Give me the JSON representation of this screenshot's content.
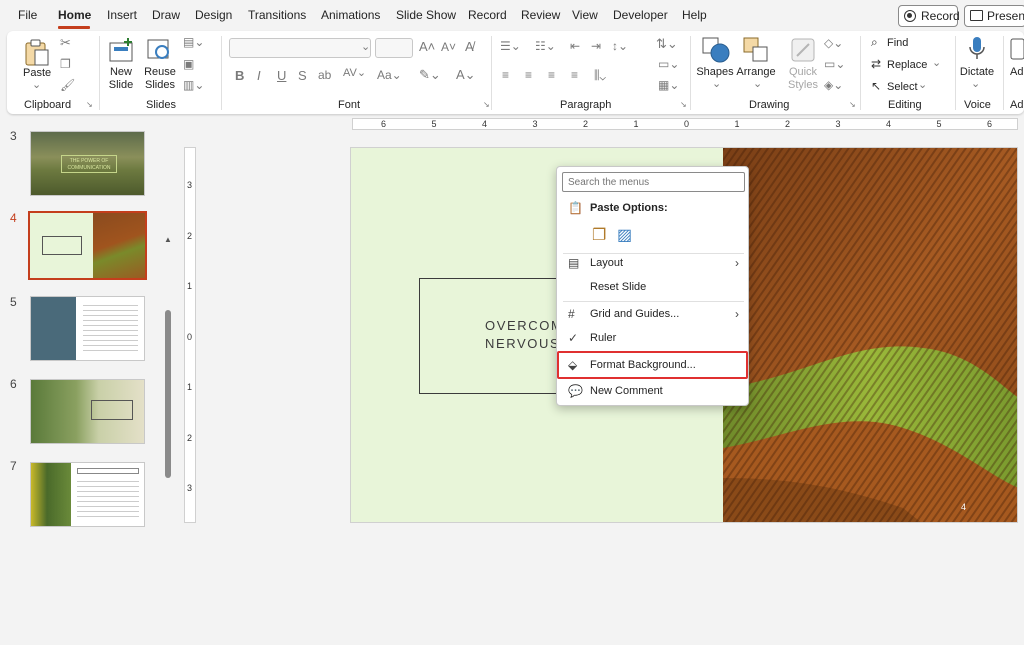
{
  "menu": {
    "tabs": [
      "File",
      "Home",
      "Insert",
      "Draw",
      "Design",
      "Transitions",
      "Animations",
      "Slide Show",
      "Record",
      "Review",
      "View",
      "Developer",
      "Help"
    ],
    "record_button": "Record",
    "present_button": "Present"
  },
  "ribbon": {
    "clipboard": {
      "paste": "Paste",
      "group": "Clipboard"
    },
    "slides": {
      "new_slide_1": "New",
      "new_slide_2": "Slide",
      "reuse_1": "Reuse",
      "reuse_2": "Slides",
      "group": "Slides"
    },
    "font": {
      "group": "Font"
    },
    "paragraph": {
      "group": "Paragraph"
    },
    "drawing": {
      "shapes": "Shapes",
      "arrange": "Arrange",
      "quick_styles_1": "Quick",
      "quick_styles_2": "Styles",
      "group": "Drawing"
    },
    "editing": {
      "find": "Find",
      "replace": "Replace",
      "select": "Select",
      "group": "Editing"
    },
    "voice": {
      "dictate": "Dictate",
      "group": "Voice"
    },
    "addins": {
      "label": "Ad",
      "group": "Ad"
    }
  },
  "thumbnails": {
    "numbers": [
      "3",
      "4",
      "5",
      "6",
      "7"
    ],
    "slide3_title_1": "THE POWER OF",
    "slide3_title_2": "COMMUNICATION"
  },
  "slide": {
    "title_line1": "OVERCOM",
    "title_line2": "NERVOUS",
    "number": "4"
  },
  "context_menu": {
    "search_placeholder": "Search the menus",
    "paste_options": "Paste Options:",
    "items": [
      "Layout",
      "Reset Slide",
      "Grid and Guides...",
      "Ruler",
      "Format Background...",
      "New Comment"
    ]
  },
  "hruler": [
    "6",
    "5",
    "4",
    "3",
    "2",
    "1",
    "0",
    "1",
    "2",
    "3",
    "4",
    "5",
    "6"
  ],
  "vruler": [
    "3",
    "2",
    "1",
    "0",
    "1",
    "2",
    "3"
  ],
  "colors": {
    "accent": "#c43e1c",
    "highlight": "#e03030",
    "slide_bg": "#e8f5d9"
  }
}
